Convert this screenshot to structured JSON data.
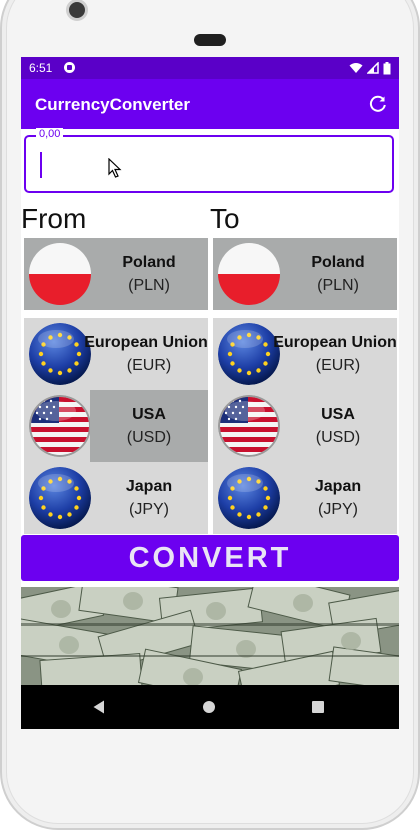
{
  "status_bar": {
    "time": "6:51"
  },
  "app_bar": {
    "title": "CurrencyConverter",
    "refresh_icon": "refresh-icon"
  },
  "amount_input": {
    "hint": "0,00",
    "value": ""
  },
  "columns": {
    "from_label": "From",
    "to_label": "To"
  },
  "from_currencies": [
    {
      "name": "Poland",
      "code": "(PLN)",
      "flag": "poland-flag",
      "selected": true
    },
    {
      "name": "European Union",
      "code": "(EUR)",
      "flag": "eu-flag",
      "selected": false
    },
    {
      "name": "USA",
      "code": "(USD)",
      "flag": "usa-flag",
      "selected": "info-only"
    },
    {
      "name": "Japan",
      "code": "(JPY)",
      "flag": "eu-flag",
      "selected": false
    }
  ],
  "to_currencies": [
    {
      "name": "Poland",
      "code": "(PLN)",
      "flag": "poland-flag",
      "selected": true
    },
    {
      "name": "European Union",
      "code": "(EUR)",
      "flag": "eu-flag",
      "selected": false
    },
    {
      "name": "USA",
      "code": "(USD)",
      "flag": "usa-flag",
      "selected": false
    },
    {
      "name": "Japan",
      "code": "(JPY)",
      "flag": "eu-flag",
      "selected": false
    }
  ],
  "convert_button": {
    "label": "CONVERT"
  },
  "colors": {
    "primary": "#6c00f0",
    "status_bar": "#5a00c8",
    "card": "#d8d8d8",
    "card_selected": "#a9abab"
  }
}
